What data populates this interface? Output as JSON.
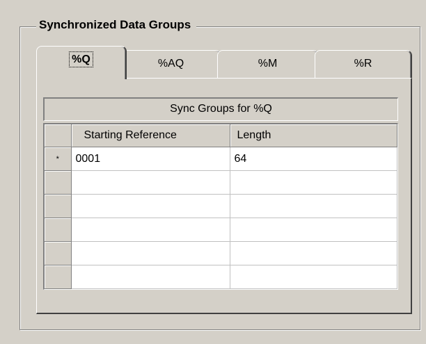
{
  "group": {
    "title": "Synchronized Data Groups"
  },
  "tabs": [
    {
      "label": "%Q",
      "active": true
    },
    {
      "label": "%AQ",
      "active": false
    },
    {
      "label": "%M",
      "active": false
    },
    {
      "label": "%R",
      "active": false
    }
  ],
  "grid": {
    "caption": "Sync Groups for %Q",
    "columns": [
      "Starting Reference",
      "Length"
    ],
    "new_row_marker": "*",
    "rows": [
      [
        "0001",
        "64"
      ],
      [
        "",
        ""
      ],
      [
        "",
        ""
      ],
      [
        "",
        ""
      ],
      [
        "",
        ""
      ],
      [
        "",
        ""
      ]
    ]
  }
}
